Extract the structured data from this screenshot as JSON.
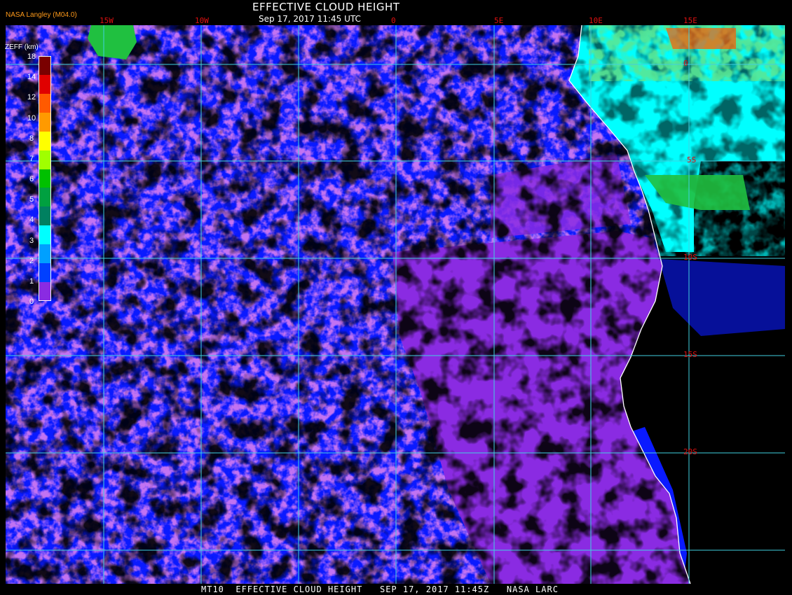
{
  "header": {
    "title": "EFFECTIVE CLOUD HEIGHT",
    "subtitle": "Sep 17, 2017 11:45 UTC",
    "credit": "NASA Langley (M04.0)"
  },
  "footer": "MT10  EFFECTIVE CLOUD HEIGHT   SEP 17, 2017 11:45Z   NASA LARC",
  "map": {
    "longitude_labels": [
      "15W",
      "10W",
      "0",
      "5E",
      "10E",
      "15E"
    ],
    "latitude_labels": [
      "0",
      "5S",
      "10S",
      "15S",
      "20S"
    ],
    "coastline": "west coast of Africa",
    "gridline_color": "#40d0e0",
    "label_color": "#e01010"
  },
  "legend": {
    "title": "ZEFF (km)",
    "ticks": [
      "18",
      "14",
      "12",
      "10",
      "8",
      "7",
      "6",
      "5",
      "4",
      "3",
      "2",
      "1",
      "0"
    ],
    "colors": [
      "#7a0000",
      "#e00000",
      "#ff5a00",
      "#ff9a00",
      "#ffff00",
      "#a0ff00",
      "#00c000",
      "#00a040",
      "#008060",
      "#00ffff",
      "#00a0ff",
      "#0040ff",
      "#8a2be2"
    ]
  },
  "colors": {
    "background": "#000000",
    "low_cloud": "#8a2be2",
    "mid_low_cloud": "#0a1aff",
    "cyan_cloud": "#00ffff",
    "coast": "#ffffff"
  }
}
